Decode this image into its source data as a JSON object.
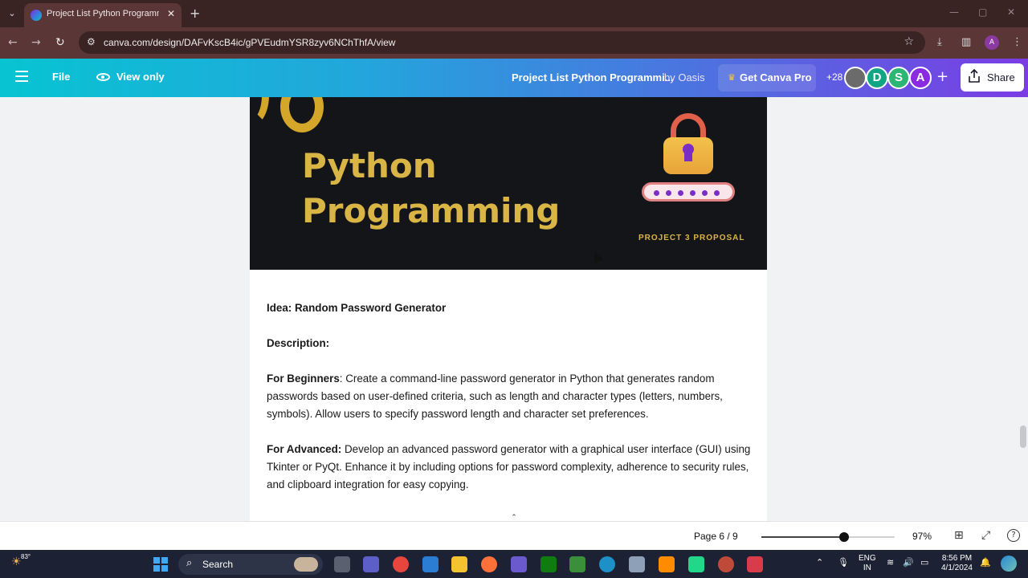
{
  "browser": {
    "tab_title": "Project List Python Programmi",
    "tab_close": "✕",
    "new_tab": "+",
    "url": "canva.com/design/DAFvKscB4ic/gPVEudmYSR8zyv6NChThfA/view",
    "profile_initial": "A",
    "icons": [
      "back-icon",
      "forward-icon",
      "reload-icon",
      "site-info-icon",
      "star-icon",
      "download-icon",
      "sidepanel-icon",
      "menu-dots-icon"
    ]
  },
  "canva": {
    "file_label": "File",
    "view_only_label": "View only",
    "doc_title": "Project List Python Programmi...",
    "doc_by": "by Oasis",
    "get_pro_label": "Get Canva Pro",
    "collab_count": "+28",
    "avatars": [
      {
        "initial": "",
        "color": "#6b6b6b"
      },
      {
        "initial": "D",
        "color": "#11a683"
      },
      {
        "initial": "S",
        "color": "#2bb673"
      },
      {
        "initial": "A",
        "color": "#8a2be2"
      }
    ],
    "share_label": "Share"
  },
  "page": {
    "banner_title_line1": "Python",
    "banner_title_line2": "Programming",
    "proposal_label": "PROJECT 3 PROPOSAL",
    "idea": "Idea: Random Password Generator",
    "description_label": "Description:",
    "beginners_label": "For Beginners",
    "beginners_text": ": Create a command-line password generator in Python that generates random passwords based on user-defined criteria, such as length and character types (letters, numbers, symbols). Allow users to specify password length and character set preferences.",
    "advanced_label": "For Advanced:",
    "advanced_text": " Develop an advanced password generator with a graphical user interface (GUI) using Tkinter or PyQt. Enhance it by including options for password complexity, adherence to security rules, and clipboard integration for easy copying."
  },
  "footer": {
    "page_indicator": "Page 6 / 9",
    "zoom_percent": 97,
    "zoom_label": "97%"
  },
  "taskbar": {
    "temperature": "83°",
    "search_label": "Search",
    "lang_line1": "ENG",
    "lang_line2": "IN",
    "time": "8:56 PM",
    "date": "4/1/2024"
  }
}
